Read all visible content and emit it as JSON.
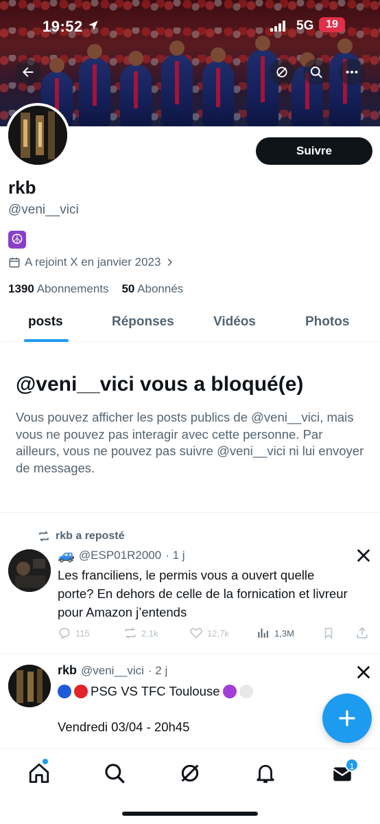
{
  "status_bar": {
    "time": "19:52",
    "network": "5G",
    "battery": "19"
  },
  "header_icons": [
    "back-arrow-icon",
    "grok-icon",
    "search-icon",
    "more-icon"
  ],
  "profile": {
    "follow_label": "Suivre",
    "name": "rkb",
    "handle": "@veni__vici",
    "bio_emoji": "☮",
    "joined": "A rejoint X en janvier 2023",
    "following_count": "1390",
    "following_label": "Abonnements",
    "followers_count": "50",
    "followers_label": "Abonnés"
  },
  "tabs": [
    {
      "label": "posts",
      "active": true
    },
    {
      "label": "Réponses",
      "active": false
    },
    {
      "label": "Vidéos",
      "active": false
    },
    {
      "label": "Photos",
      "active": false
    }
  ],
  "blocked": {
    "title": "@veni__vici vous a bloqué(e)",
    "text": "Vous pouvez afficher les posts publics de @veni__vici, mais vous ne pouvez pas interagir avec cette personne. Par ailleurs, vous ne pouvez pas suivre @veni__vici ni lui envoyer de messages."
  },
  "posts": [
    {
      "repost_label": "rkb a reposté",
      "emoji": "🚙",
      "author_handle": "@ESP01R2000",
      "time": "· 1 j",
      "text": "Les franciliens, le permis vous a ouvert quelle porte? En dehors de celle de la fornication et livreur pour Amazon j’entends",
      "replies": "115",
      "reposts": "2,1k",
      "likes": "12,7k",
      "views": "1,3M"
    },
    {
      "author_name": "rkb",
      "author_handle": "@veni__vici",
      "time": "· 2 j",
      "line1": "PSG VS TFC Toulouse",
      "line2": "Vendredi 03/04 - 20h45"
    }
  ],
  "colors": {
    "accent": "#1d9bf0",
    "text": "#0f1419",
    "muted": "#536471",
    "battery": "#e0304a"
  },
  "bottom_nav": [
    "home-icon",
    "search-icon",
    "grok-icon",
    "notifications-icon",
    "messages-icon"
  ],
  "messages_badge": "1"
}
